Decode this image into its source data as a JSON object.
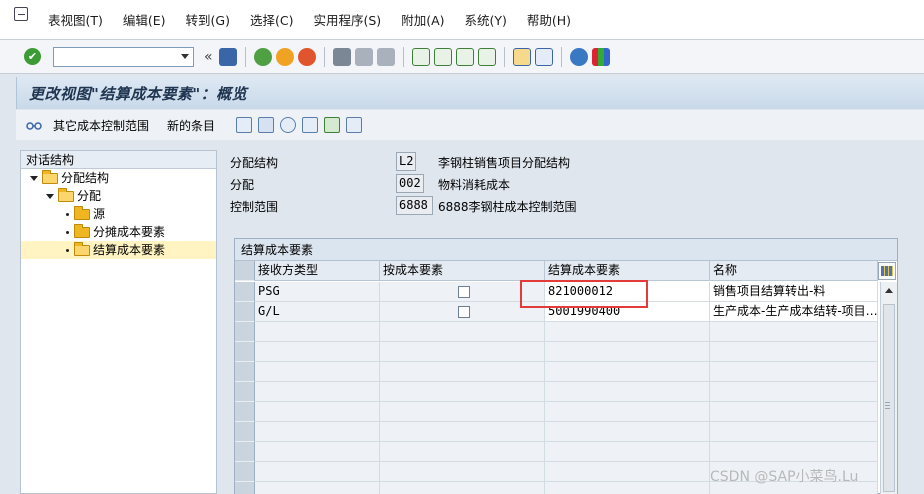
{
  "menu": [
    "表视图(T)",
    "编辑(E)",
    "转到(G)",
    "选择(C)",
    "实用程序(S)",
    "附加(A)",
    "系统(Y)",
    "帮助(H)"
  ],
  "toolbar": {
    "command_field_value": "",
    "icons": [
      "ok-icon",
      "save-icon",
      "back-icon",
      "exit-icon",
      "cancel-icon",
      "print-icon",
      "find-icon",
      "find-next-icon",
      "first-page-icon",
      "prev-page-icon",
      "next-page-icon",
      "last-page-icon",
      "create-session-icon",
      "shortcut-icon",
      "help-icon",
      "customize-layout-icon"
    ],
    "ok_glyph": "✔",
    "collapse_glyph": "«"
  },
  "title": "更改视图\"结算成本要素\"：概览",
  "app_toolbar": {
    "other_range_label": "其它成本控制范围",
    "new_entries_label": "新的条目"
  },
  "tree": {
    "header": "对话结构",
    "items": [
      {
        "label": "分配结构",
        "level": 0,
        "expanded": true
      },
      {
        "label": "分配",
        "level": 1,
        "expanded": true
      },
      {
        "label": "源",
        "level": 2
      },
      {
        "label": "分摊成本要素",
        "level": 2
      },
      {
        "label": "结算成本要素",
        "level": 2,
        "selected": true
      }
    ]
  },
  "header_fields": [
    {
      "label": "分配结构",
      "value": "L2",
      "desc": "李钢柱销售项目分配结构"
    },
    {
      "label": "分配",
      "value": "002",
      "desc": "物料消耗成本"
    },
    {
      "label": "控制范围",
      "value": "6888",
      "desc": "6888李钢柱成本控制范围"
    }
  ],
  "table": {
    "title": "结算成本要素",
    "columns": [
      "接收方类型",
      "按成本要素",
      "结算成本要素",
      "名称"
    ],
    "rows": [
      {
        "receiver": "PSG",
        "by_element": false,
        "element": "821000012",
        "name": "销售项目结算转出-料"
      },
      {
        "receiver": "G/L",
        "by_element": false,
        "element": "5001990400",
        "name": "生产成本-生产成本结转-项目…"
      }
    ],
    "empty_rows": 9
  },
  "watermark": "CSDN @SAP小菜鸟.Lu",
  "colors": {
    "highlight_box": "#e33a3a",
    "title_text": "#1f3550",
    "selected_node": "#fff4c2"
  }
}
